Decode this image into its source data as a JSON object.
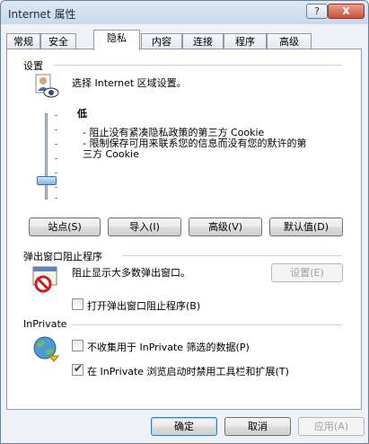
{
  "window": {
    "title": "Internet 属性",
    "help_label": "?",
    "close_label": "X"
  },
  "tabs": [
    "常规",
    "安全",
    "隐私",
    "内容",
    "连接",
    "程序",
    "高级"
  ],
  "active_tab": "隐私",
  "settings": {
    "section_title": "设置",
    "zone_text": "选择 Internet 区域设置。",
    "level_label": "低",
    "desc_line1": "- 阻止没有紧凑隐私政策的第三方 Cookie",
    "desc_line2": "- 限制保存可用来联系您的信息而没有您的默许的第",
    "desc_line3": "三方 Cookie",
    "slider_level": 0.25,
    "buttons": {
      "sites": "站点(S)",
      "import": "导入(I)",
      "advanced": "高级(V)",
      "default": "默认值(D)"
    }
  },
  "popup": {
    "section_title": "弹出窗口阻止程序",
    "desc": "阻止显示大多数弹出窗口。",
    "settings_button": "设置(E)",
    "checkbox_label": "打开弹出窗口阻止程序(B)",
    "checkbox_checked": false
  },
  "inprivate": {
    "section_title": "InPrivate",
    "cb1_label": "不收集用于 InPrivate 筛选的数据(P)",
    "cb1_checked": false,
    "cb2_label": "在 InPrivate 浏览启动时禁用工具栏和扩展(T)",
    "cb2_checked": true
  },
  "footer": {
    "ok": "确定",
    "cancel": "取消",
    "apply": "应用(A)"
  }
}
